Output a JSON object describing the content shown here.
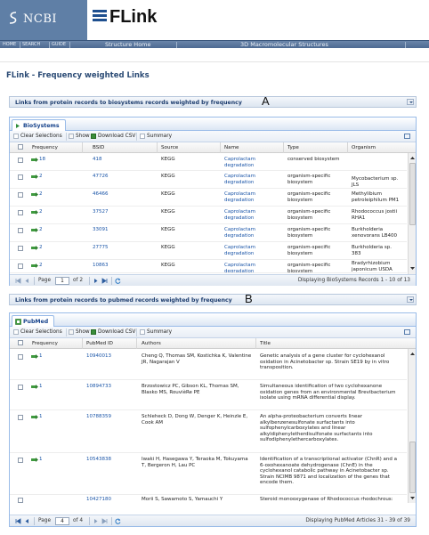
{
  "header": {
    "ncbi_logo": "NCBI",
    "app_logo": "FLink",
    "nav_small": [
      "HOME",
      "SEARCH",
      "GUIDE"
    ],
    "nav_big": [
      "Structure Home",
      "3D Macromolecular Structures"
    ]
  },
  "page_title": "FLink - Frequency weighted Links",
  "section_a": {
    "title": "Links from protein records to biosystems records weighted by frequency",
    "letter": "A"
  },
  "section_b": {
    "title": "Links from protein records to pubmed records weighted by frequency",
    "letter": "B"
  },
  "toolbar": {
    "clear": "Clear Selections",
    "show": "Show",
    "download": "Download CSV",
    "summary": "Summary"
  },
  "biosystems": {
    "tab": "BioSystems",
    "columns": [
      "Frequency",
      "BSID",
      "Source",
      "Name",
      "Type",
      "Organism"
    ],
    "rows": [
      {
        "freq": "18",
        "bsid": "418",
        "source": "KEGG",
        "name": "Caprolactam degradation",
        "type": "conserved biosystem",
        "organism": ""
      },
      {
        "freq": "2",
        "bsid": "47726",
        "source": "KEGG",
        "name": "Caprolactam degradation",
        "type": "organism-specific biosystem",
        "organism": "Mycobacterium sp. JLS"
      },
      {
        "freq": "2",
        "bsid": "46466",
        "source": "KEGG",
        "name": "Caprolactam degradation",
        "type": "organism-specific biosystem",
        "organism": "Methylibium petroleiphilum PM1"
      },
      {
        "freq": "2",
        "bsid": "37527",
        "source": "KEGG",
        "name": "Caprolactam degradation",
        "type": "organism-specific biosystem",
        "organism": "Rhodococcus jostii RHA1"
      },
      {
        "freq": "2",
        "bsid": "33091",
        "source": "KEGG",
        "name": "Caprolactam degradation",
        "type": "organism-specific biosystem",
        "organism": "Burkholderia xenovorans LB400"
      },
      {
        "freq": "2",
        "bsid": "27775",
        "source": "KEGG",
        "name": "Caprolactam degradation",
        "type": "organism-specific biosystem",
        "organism": "Burkholderia sp. 383"
      },
      {
        "freq": "2",
        "bsid": "10863",
        "source": "KEGG",
        "name": "Caprolactam degradation",
        "type": "organism-specific biosystem",
        "organism": "Bradyrhizobium japonicum USDA 110"
      }
    ],
    "pager": {
      "page_label": "Page",
      "page": "1",
      "of": "of 2",
      "display": "Displaying BioSystems Records 1 - 10 of 13"
    }
  },
  "pubmed": {
    "tab": "PubMed",
    "columns": [
      "Frequency",
      "PubMed ID",
      "Authors",
      "Title"
    ],
    "rows": [
      {
        "freq": "1",
        "pmid": "10940013",
        "authors": "Cheng Q, Thomas SM, Kostichka K, Valentine JR, Nagarajan V",
        "title": "Genetic analysis of a gene cluster for cyclohexanol oxidation in Acinetobacter sp. Strain SE19 by in vitro transposition."
      },
      {
        "freq": "1",
        "pmid": "10894733",
        "authors": "Brzostowicz PC, Gibson KL, Thomas SM, Blasko MS, RouvièRe PE",
        "title": "Simultaneous identification of two cyclohexanone oxidation genes from an environmental Brevibacterium isolate using mRNA differential display."
      },
      {
        "freq": "1",
        "pmid": "10788359",
        "authors": "Schleheck D, Dong W, Denger K, Heinzle E, Cook AM",
        "title": "An alpha-proteobacterium converts linear alkylbenzenesulfonate surfactants into sulfophenylcarboxylates and linear alkyldiphenyletherdisulfonate surfactants into sulfodiphenylethercarboxylates."
      },
      {
        "freq": "1",
        "pmid": "10543838",
        "authors": "Iwaki H, Hasegawa Y, Teraoka M, Tokuyama T, Bergeron H, Lau PC",
        "title": "Identification of a transcriptional activator (ChnR) and a 6-oxohexanoate dehydrogenase (ChnE) in the cyclohexanol catabolic pathway in Acinetobacter sp. Strain NCIMB 9871 and localization of the genes that encode them."
      },
      {
        "freq": "1",
        "pmid": "10427180",
        "authors": "Morii S, Sawamoto S, Yamauchi Y",
        "title": "Steroid monooxygenase of Rhodococcus rhodochrous:"
      }
    ],
    "pager": {
      "page_label": "Page",
      "page": "4",
      "of": "of 4",
      "display": "Displaying PubMed Articles 31 - 39 of 39"
    }
  },
  "colors": {
    "nav": "#5f7fa6",
    "link": "#1a55a8",
    "panel_border": "#99bbe8",
    "title": "#2a4a74"
  },
  "icons": [
    "ncbi-swirl-icon",
    "flink-bars-icon",
    "biosystems-tab-icon",
    "pubmed-tab-icon",
    "help-icon",
    "refresh-icon",
    "frequency-link-icon"
  ]
}
